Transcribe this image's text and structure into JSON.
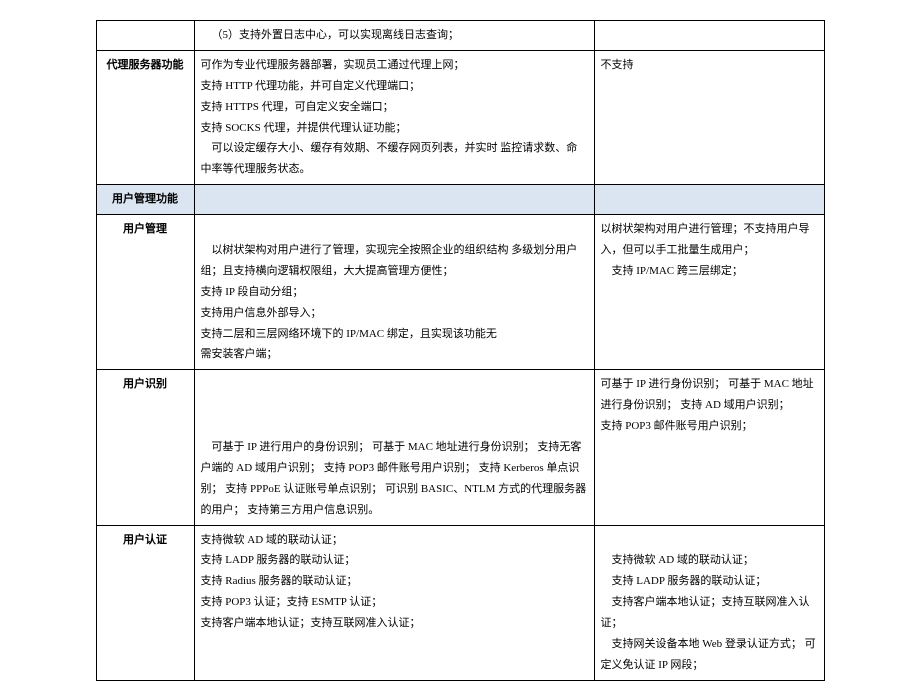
{
  "row_top": {
    "col1": "",
    "col2": "（5）支持外置日志中心，可以实现离线日志查询；",
    "col3": ""
  },
  "row_proxy": {
    "label": "代理服务器功能",
    "col2_l1": "可作为专业代理服务器部署，实现员工通过代理上网；",
    "col2_l2": "支持 HTTP 代理功能，并可自定义代理端口；",
    "col2_l3": "支持 HTTPS 代理，可自定义安全端口；",
    "col2_l4": "支持 SOCKS 代理，并提供代理认证功能；",
    "col2_l5": "可以设定缓存大小、缓存有效期、不缓存网页列表，并实时 监控请求数、命中率等代理服务状态。",
    "col3": "不支持"
  },
  "section_user": "用户管理功能",
  "row_user_mgmt": {
    "label": "用户管理",
    "col2_l1": "以树状架构对用户进行了管理，实现完全按照企业的组织结构 多级划分用户组；且支持横向逻辑权限组，大大提高管理方便性；",
    "col2_l2": "支持 IP 段自动分组；",
    "col2_l3": "支持用户信息外部导入；",
    "col2_l4": "支持二层和三层网络环境下的 IP/MAC 绑定，且实现该功能无",
    "col2_l5": "需安装客户端；",
    "col3_l1": "以树状架构对用户进行管理；不支持用户导入，但可以手工批量生成用户；",
    "col3_l2": "支持 IP/MAC 跨三层绑定；"
  },
  "row_user_rec": {
    "label": "用户识别",
    "col2_l1": "可基于 IP 进行用户的身份识别； 可基于 MAC 地址进行身份识别； 支持无客户端的 AD 域用户识别； 支持 POP3 邮件账号用户识别； 支持 Kerberos 单点识别； 支持 PPPoE 认证账号单点识别； 可识别 BASIC、NTLM 方式的代理服务器的用户； 支持第三方用户信息识别。",
    "col3_l1": "可基于 IP 进行身份识别； 可基于 MAC 地址进行身份识别； 支持 AD 域用户识别；",
    "col3_l2": "支持 POP3 邮件账号用户识别；"
  },
  "row_user_auth": {
    "label": "用户认证",
    "col2_l1": "支持微软 AD 域的联动认证；",
    "col2_l2": "支持 LADP 服务器的联动认证；",
    "col2_l3": "支持 Radius 服务器的联动认证；",
    "col2_l4": "支持 POP3 认证；支持 ESMTP 认证；",
    "col2_l5": "支持客户端本地认证；支持互联网准入认证；",
    "col3_l1": "支持微软 AD 域的联动认证；",
    "col3_l2": "支持 LADP 服务器的联动认证；",
    "col3_l3": "支持客户端本地认证；支持互联网准入认证；",
    "col3_l4": "支持网关设备本地 Web 登录认证方式； 可定义免认证 IP 网段；"
  }
}
